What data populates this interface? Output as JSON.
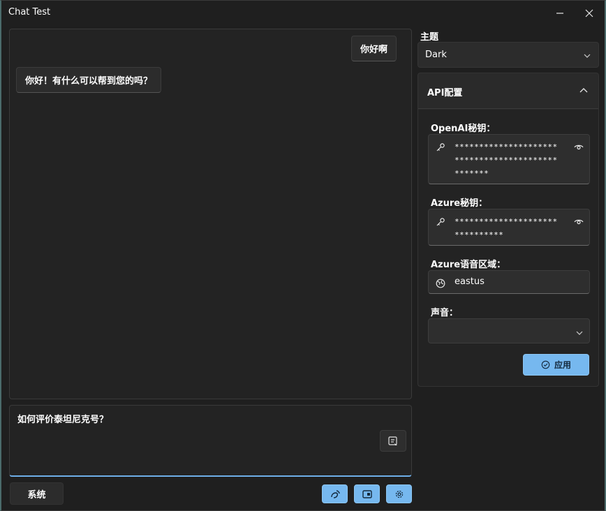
{
  "window": {
    "title": "Chat Test"
  },
  "chat": {
    "messages": [
      {
        "role": "user",
        "text": "你好啊"
      },
      {
        "role": "assistant",
        "text": "你好！有什么可以帮到您的吗？"
      }
    ]
  },
  "input": {
    "value": "如何评价泰坦尼克号？"
  },
  "bottom": {
    "system_label": "系统"
  },
  "settings": {
    "theme_label": "主题",
    "theme_value": "Dark",
    "api_title": "API配置",
    "openai_label": "OpenAI秘钥：",
    "openai_value": "*************************************************",
    "azure_key_label": "Azure秘钥：",
    "azure_key_value": "*******************************",
    "azure_region_label": "Azure语音区域：",
    "azure_region_value": "eastus",
    "voice_label": "声音：",
    "voice_value": "",
    "apply_label": "应用"
  },
  "colors": {
    "accent": "#76b8ef",
    "background": "#1f1f1f"
  },
  "icons": [
    "minimize-icon",
    "close-icon",
    "send-note-icon",
    "voice-icon",
    "image-icon",
    "gear-icon",
    "key-icon",
    "eye-icon",
    "globe-icon",
    "chevron-down-icon",
    "chevron-up-icon",
    "check-circle-icon"
  ]
}
